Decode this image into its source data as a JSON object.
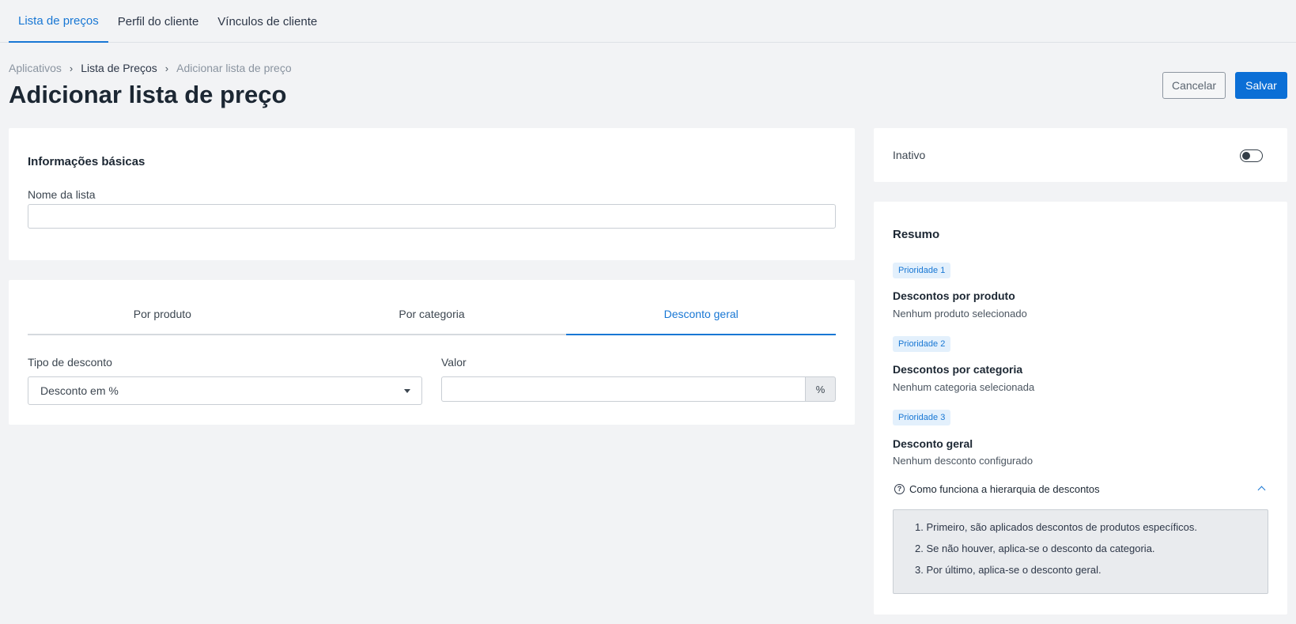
{
  "topnav": {
    "tabs": [
      {
        "label": "Lista de preços",
        "active": true
      },
      {
        "label": "Perfil do cliente",
        "active": false
      },
      {
        "label": "Vínculos de cliente",
        "active": false
      }
    ]
  },
  "breadcrumb": [
    "Aplicativos",
    "Lista de Preços",
    "Adicionar lista de preço"
  ],
  "page": {
    "title": "Adicionar lista de preço"
  },
  "actions": {
    "cancel": "Cancelar",
    "save": "Salvar"
  },
  "basic_info": {
    "title": "Informações básicas",
    "name_label": "Nome da lista",
    "name_value": ""
  },
  "discount": {
    "tabs": [
      "Por produto",
      "Por categoria",
      "Desconto geral"
    ],
    "active_tab": "Desconto geral",
    "type_label": "Tipo de desconto",
    "type_value": "Desconto em %",
    "value_label": "Valor",
    "value": "",
    "value_suffix": "%"
  },
  "status": {
    "label": "Inativo",
    "enabled": false
  },
  "summary": {
    "title": "Resumo",
    "priorities": [
      {
        "badge": "Prioridade 1",
        "title": "Descontos por produto",
        "desc": "Nenhum produto selecionado"
      },
      {
        "badge": "Prioridade 2",
        "title": "Descontos por categoria",
        "desc": "Nenhum categoria selecionada"
      },
      {
        "badge": "Prioridade 3",
        "title": "Desconto geral",
        "desc": "Nenhum desconto configurado"
      }
    ],
    "help": {
      "title": "Como funciona a hierarquia de descontos",
      "steps": [
        "1. Primeiro, são aplicados descontos de produtos específicos.",
        "2. Se não houver, aplica-se o desconto da categoria.",
        "3. Por último, aplica-se o desconto geral."
      ]
    }
  },
  "colors": {
    "accent": "#1877d4",
    "primary_button": "#0b6fd6",
    "background": "#f2f3f5"
  },
  "icons": [
    "chevron-right-icon",
    "caret-down-icon",
    "question-circle-icon",
    "chevron-up-icon"
  ]
}
